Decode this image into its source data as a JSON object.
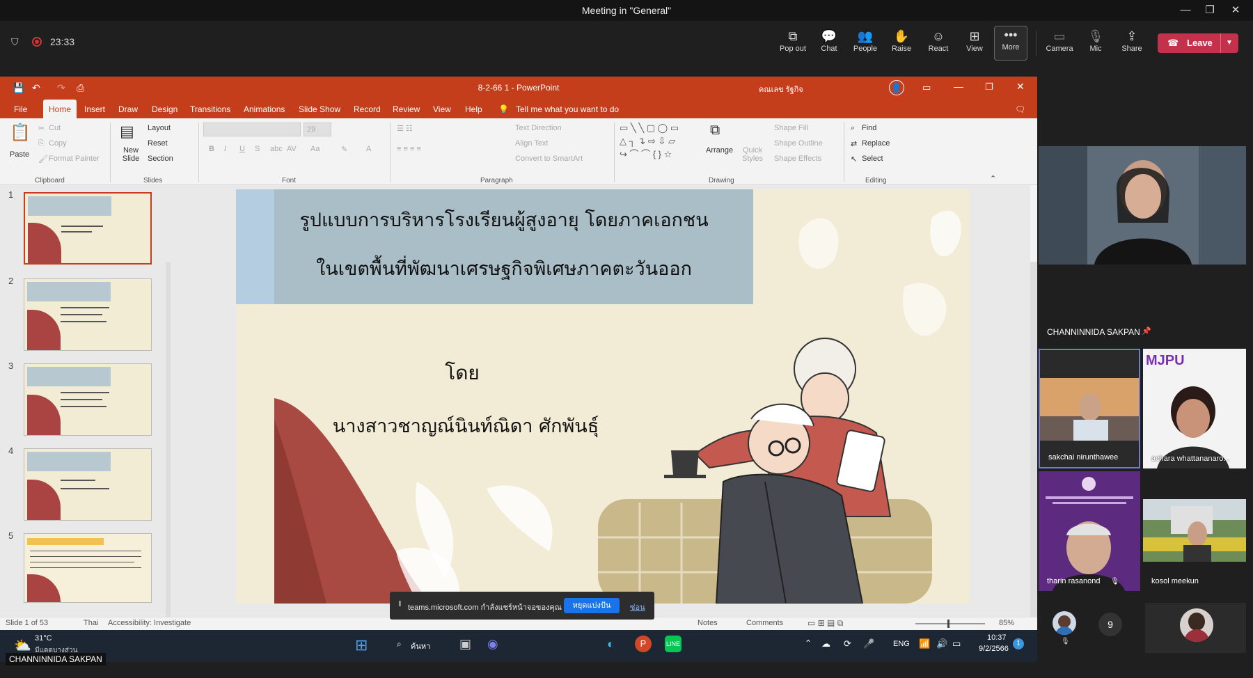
{
  "window_title": "Meeting in \"General\"",
  "timer": "23:33",
  "toolbar": {
    "popout": "Pop out",
    "chat": "Chat",
    "people": "People",
    "raise": "Raise",
    "react": "React",
    "view": "View",
    "more": "More",
    "camera": "Camera",
    "mic": "Mic",
    "share": "Share",
    "leave": "Leave"
  },
  "ppt": {
    "title": "8-2-66 1 - PowerPoint",
    "user": "คณเลข รัฐกิจ",
    "menu": [
      "File",
      "Home",
      "Insert",
      "Draw",
      "Design",
      "Transitions",
      "Animations",
      "Slide Show",
      "Record",
      "Review",
      "View",
      "Help"
    ],
    "tell_me": "Tell me what you want to do",
    "clipboard": {
      "paste": "Paste",
      "cut": "Cut",
      "copy": "Copy",
      "format_painter": "Format Painter",
      "group": "Clipboard"
    },
    "slides": {
      "new_slide": "New Slide",
      "layout": "Layout",
      "reset": "Reset",
      "section": "Section",
      "group": "Slides"
    },
    "font": {
      "size": "29",
      "group": "Font"
    },
    "paragraph": {
      "text_direction": "Text Direction",
      "align_text": "Align Text",
      "convert": "Convert to SmartArt",
      "group": "Paragraph"
    },
    "drawing": {
      "arrange": "Arrange",
      "quick_styles": "Quick Styles",
      "shape_fill": "Shape Fill",
      "shape_outline": "Shape Outline",
      "shape_effects": "Shape Effects",
      "group": "Drawing"
    },
    "editing": {
      "find": "Find",
      "replace": "Replace",
      "select": "Select",
      "group": "Editing"
    },
    "thumb_numbers": [
      "1",
      "2",
      "3",
      "4",
      "5"
    ],
    "slide": {
      "line1": "รูปแบบการบริหารโรงเรียนผู้สูงอายุ โดยภาคเอกชน",
      "line2": "ในเขตพื้นที่พัฒนาเศรษฐกิจพิเศษภาคตะวันออก",
      "by": "โดย",
      "author": "นางสาวชาญณ์นินท์ณิดา ศักพันธุ์"
    },
    "status": {
      "slide": "Slide 1 of 53",
      "lang": "Thai",
      "accessibility": "Accessibility: Investigate",
      "notes": "Notes",
      "comments": "Comments",
      "zoom": "85%"
    }
  },
  "sharebar": {
    "text": "teams.microsoft.com กำลังแชร์หน้าจอของคุณ",
    "stop": "หยุดแบ่งปัน",
    "hide": "ซ่อน"
  },
  "taskbar": {
    "weather_temp": "31°C",
    "weather_desc": "มีแดดบางส่วน",
    "search": "ค้นหา",
    "lang": "ENG",
    "time": "10:37",
    "date": "9/2/2566",
    "notif": "1"
  },
  "presenter_label": "CHANNINNIDA SAKPAN",
  "participants": {
    "main": "CHANNINNIDA SAKPAN",
    "p1": "sakchai nirunthawee",
    "p2": "achara whattananaro...",
    "p3": "tharin rasanond",
    "p4": "kosol meekun",
    "p2_logo": "MJPU",
    "more_count": "9"
  }
}
